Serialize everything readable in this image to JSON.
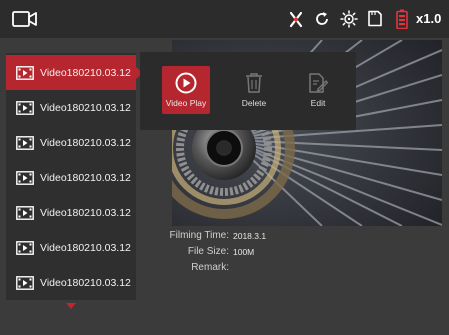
{
  "status_bar": {
    "zoom": "x1.0",
    "icons": [
      "camera-icon",
      "gps-off-icon",
      "loop-icon",
      "exposure-icon",
      "sd-card-icon",
      "battery-icon"
    ],
    "battery_color": "#e5333c"
  },
  "video_list": {
    "items": [
      {
        "label": "Video180210.03.12"
      },
      {
        "label": "Video180210.03.12"
      },
      {
        "label": "Video180210.03.12"
      },
      {
        "label": "Video180210.03.12"
      },
      {
        "label": "Video180210.03.12"
      },
      {
        "label": "Video180210.03.12"
      },
      {
        "label": "Video180210.03.12"
      }
    ],
    "active_index": 0,
    "accent_color": "#b5262f"
  },
  "popup": {
    "play_label": "Video Play",
    "delete_label": "Delete",
    "edit_label": "Edit"
  },
  "details": {
    "filming_time_label": "Filming Time:",
    "filming_time_value": "2018.3.1",
    "file_size_label": "File Size:",
    "file_size_value": "100M",
    "remark_label": "Remark:",
    "remark_value": ""
  }
}
